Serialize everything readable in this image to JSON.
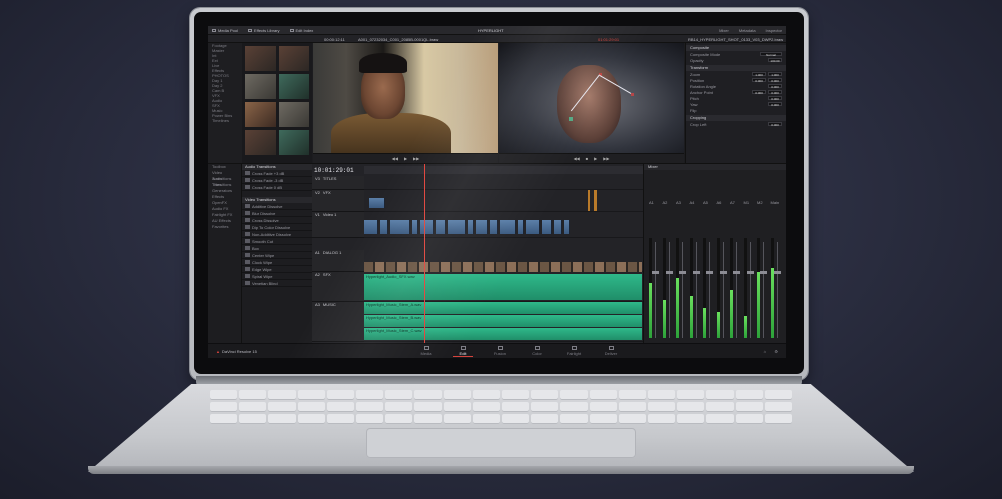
{
  "topbar": {
    "tabs": [
      "Media Pool",
      "Effects Library",
      "Edit Index"
    ],
    "project_title": "HYPERLIGHT",
    "right": [
      "Mixer",
      "Metadata",
      "Inspector"
    ]
  },
  "header": {
    "left_clip": "A001_07232034_C001_2085B-0001QL.braw",
    "left_tc": "00:00:12:11",
    "right_tc": "01:01:29:01",
    "inspector_title": "RB14_HYPERLIGHT_SHOT_0133_V03_DWP2.braw"
  },
  "bins": [
    "Footage",
    "Master",
    "Int",
    "Ext",
    "Live",
    "Effects",
    "PHOTOS",
    "Day 1",
    "Day 2",
    "Cam B",
    "VFX",
    "Audio",
    "SFX",
    "Music",
    "Power Bins",
    "Timelines"
  ],
  "inspector": {
    "sections": [
      "Composite",
      "Transform",
      "Cropping"
    ],
    "composite_rows": [
      {
        "label": "Composite Mode",
        "value": "Normal"
      },
      {
        "label": "Opacity",
        "value": "100.00"
      }
    ],
    "transform_rows": [
      {
        "label": "Zoom",
        "x": "1.000",
        "y": "1.000"
      },
      {
        "label": "Position",
        "x": "0.000",
        "y": "0.000"
      },
      {
        "label": "Rotation Angle",
        "x": "0.000",
        "y": ""
      },
      {
        "label": "Anchor Point",
        "x": "0.000",
        "y": "0.000"
      },
      {
        "label": "Pitch",
        "x": "0.000",
        "y": ""
      },
      {
        "label": "Yaw",
        "x": "0.000",
        "y": ""
      },
      {
        "label": "Flip",
        "x": "",
        "y": ""
      }
    ],
    "cropping_rows": [
      {
        "label": "Crop Left",
        "x": "0.000"
      }
    ]
  },
  "effects": {
    "tree": [
      "Toolbox",
      "Video Transitions",
      "Audio Transitions",
      "Titles",
      "Generators",
      "Effects",
      "OpenFX",
      "Audio FX",
      "Fairlight FX",
      "AU Effects",
      "Favorites"
    ],
    "audio_header": "Audio Transitions",
    "audio_items": [
      "Cross Fade +3 dB",
      "Cross Fade -3 dB",
      "Cross Fade 0 dB"
    ],
    "video_header": "Video Transitions",
    "video_items": [
      "Additive Dissolve",
      "Blur Dissolve",
      "Cross Dissolve",
      "Dip To Color Dissolve",
      "Non-Additive Dissolve",
      "Smooth Cut",
      "Box",
      "Center Wipe",
      "Clock Wipe",
      "Edge Wipe",
      "Spiral Wipe",
      "Venetian Blind"
    ]
  },
  "timeline": {
    "timecode": "10:01:29:01",
    "tracks": [
      {
        "id": "V3",
        "name": "TITLES"
      },
      {
        "id": "V2",
        "name": "VFX"
      },
      {
        "id": "V1",
        "name": "Video 1"
      },
      {
        "id": "A1",
        "name": "DIALOG 1"
      },
      {
        "id": "A2",
        "name": "SFX"
      },
      {
        "id": "A3",
        "name": "MUSIC"
      }
    ],
    "audio_clips": [
      "Hyperlight_Audio_SFX.wav",
      "Hyperlight_Music_Stem_A.wav",
      "Hyperlight_Music_Stem_B.wav",
      "Hyperlight_Music_Stem_C.wav"
    ]
  },
  "mixer": {
    "title": "Mixer",
    "channels": [
      "A1",
      "A2",
      "A3",
      "A4",
      "A5",
      "A6",
      "A7",
      "M1",
      "M2",
      "Main"
    ],
    "levels": [
      0.55,
      0.38,
      0.6,
      0.42,
      0.3,
      0.26,
      0.48,
      0.22,
      0.66,
      0.7
    ]
  },
  "pagebar": {
    "brand": "DaVinci Resolve 15",
    "pages": [
      "Media",
      "Edit",
      "Fusion",
      "Color",
      "Fairlight",
      "Deliver"
    ],
    "active": "Edit"
  }
}
